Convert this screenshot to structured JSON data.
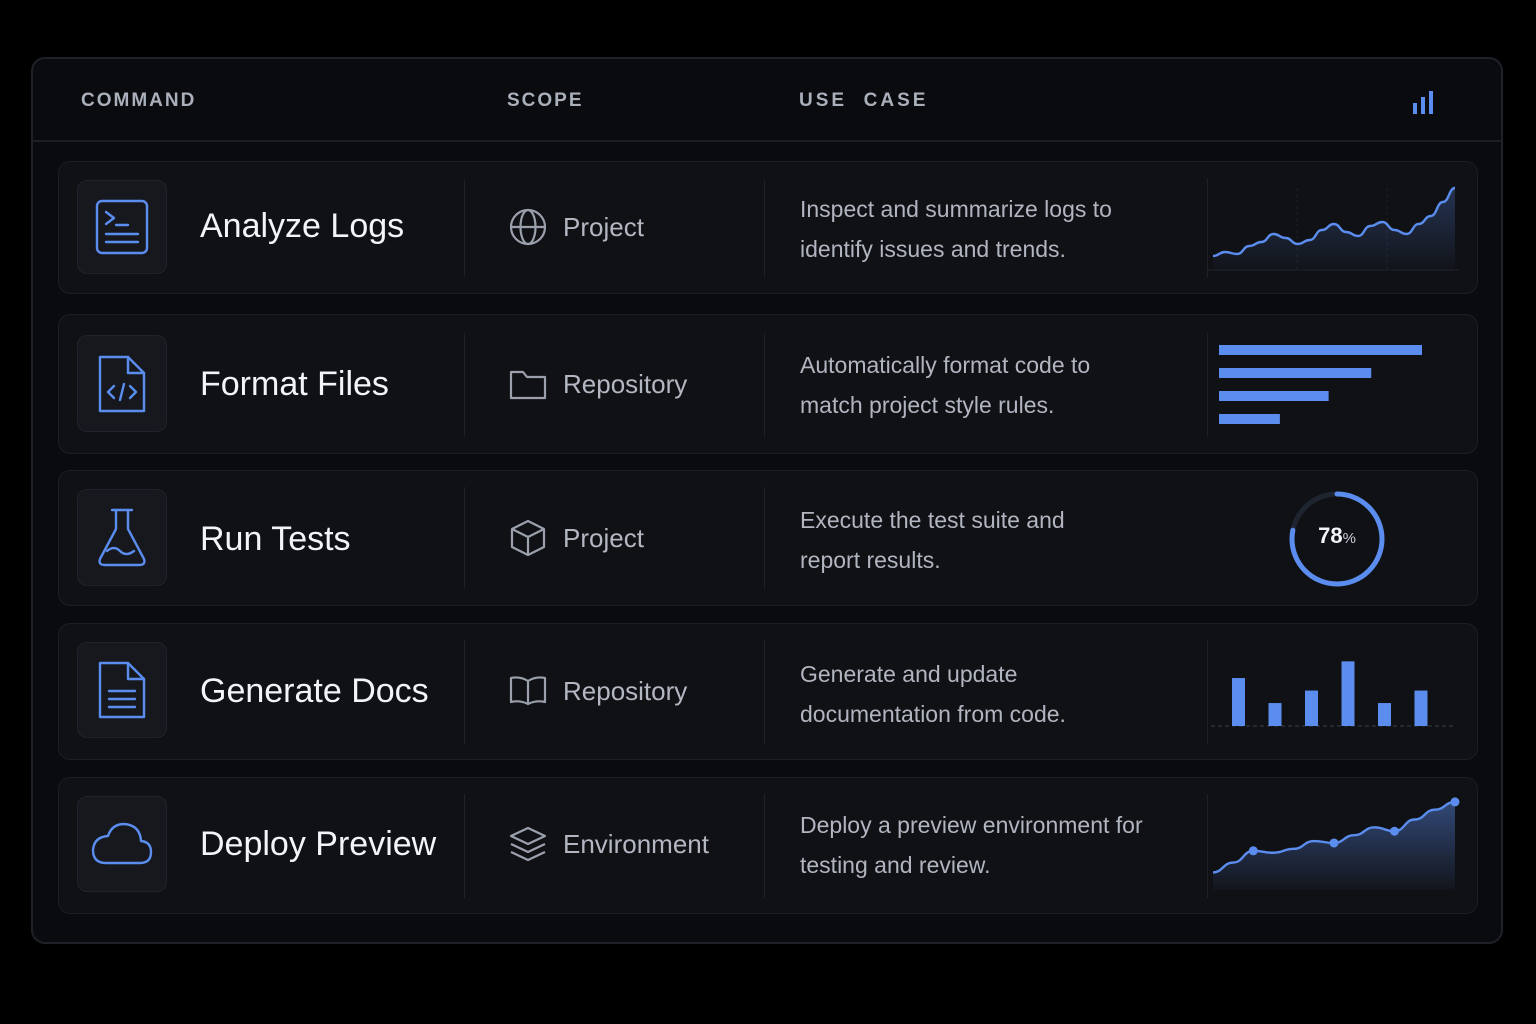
{
  "header": {
    "command": "COMMAND",
    "scope": "SCOPE",
    "use_case": "USE  CASE",
    "icon": "bar-chart-icon"
  },
  "colors": {
    "accent": "#5b8def",
    "background": "#000000",
    "panel": "#0a0b0e",
    "row": "#101115"
  },
  "rows": [
    {
      "name": "Analyze Logs",
      "icon": "terminal-file-icon",
      "scope_icon": "globe-icon",
      "scope": "Project",
      "desc_line1": "Inspect and summarize logs to",
      "desc_line2": "identify issues and trends.",
      "viz": "line-chart"
    },
    {
      "name": "Format Files",
      "icon": "code-file-icon",
      "scope_icon": "folder-icon",
      "scope": "Repository",
      "desc_line1": "Automatically format code to",
      "desc_line2": "match project style rules.",
      "viz": "horizontal-bar-chart"
    },
    {
      "name": "Run Tests",
      "icon": "flask-icon",
      "scope_icon": "cube-icon",
      "scope": "Project",
      "desc_line1": "Execute the test suite and",
      "desc_line2": "report results.",
      "viz": "progress-ring",
      "progress_value": "78",
      "progress_unit": "%",
      "progress_fraction": 0.78
    },
    {
      "name": "Generate Docs",
      "icon": "document-icon",
      "scope_icon": "book-icon",
      "scope": "Repository",
      "desc_line1": "Generate and update",
      "desc_line2": "documentation from code.",
      "viz": "vertical-bar-chart"
    },
    {
      "name": "Deploy Preview",
      "icon": "cloud-icon",
      "scope_icon": "layers-icon",
      "scope": "Environment",
      "desc_line1": "Deploy a preview environment for",
      "desc_line2": "testing and review.",
      "viz": "area-chart"
    }
  ],
  "chart_data": [
    {
      "type": "line",
      "x": [
        0,
        1,
        2,
        3,
        4,
        5,
        6,
        7,
        8,
        9,
        10,
        11,
        12,
        13,
        14,
        15,
        16,
        17,
        18,
        19,
        20
      ],
      "values": [
        8,
        12,
        10,
        18,
        22,
        30,
        26,
        20,
        24,
        34,
        40,
        32,
        28,
        38,
        42,
        34,
        30,
        40,
        48,
        62,
        76
      ],
      "ylim": [
        0,
        80
      ]
    },
    {
      "type": "bar",
      "categories": [
        "1",
        "2",
        "3",
        "4"
      ],
      "values": [
        100,
        75,
        54,
        30
      ]
    },
    {
      "type": "bar",
      "categories": [
        "1",
        "2",
        "3",
        "4",
        "5",
        "6"
      ],
      "values": [
        46,
        22,
        34,
        62,
        22,
        34
      ],
      "ylim": [
        0,
        70
      ]
    },
    {
      "type": "area",
      "x": [
        0,
        1,
        2,
        3,
        4,
        5,
        6,
        7,
        8,
        9,
        10,
        11,
        12
      ],
      "values": [
        14,
        24,
        36,
        34,
        38,
        46,
        44,
        52,
        60,
        56,
        68,
        78,
        86
      ],
      "markers_at": [
        2,
        6,
        9,
        12
      ],
      "ylim": [
        0,
        90
      ]
    }
  ]
}
